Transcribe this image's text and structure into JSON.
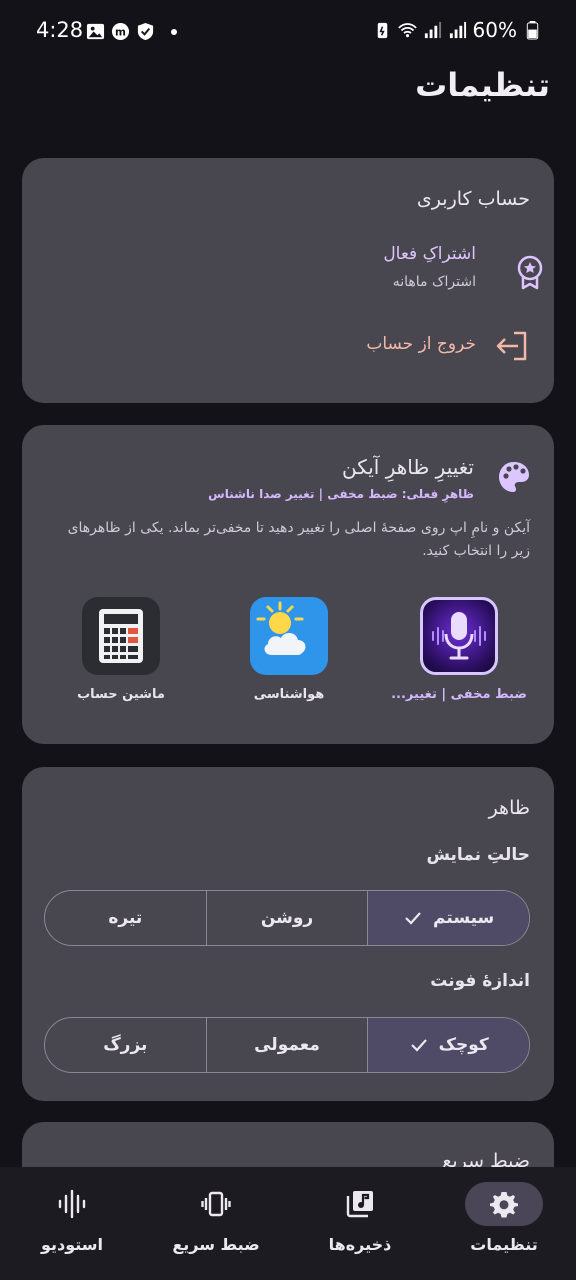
{
  "status_bar": {
    "time": "4:28",
    "battery": "60%",
    "left_icons": [
      "image-icon",
      "messenger-icon",
      "shield-check-icon"
    ],
    "right_icons": [
      "battery-saver-icon",
      "wifi-icon",
      "signal-icon",
      "signal-icon",
      "battery-icon"
    ]
  },
  "page": {
    "title": "تنظیمات"
  },
  "account": {
    "heading": "حساب کاربری",
    "subscription_title": "اشتراکِ فعال",
    "subscription_sub": "اشتراک ماهانه",
    "logout": "خروج از حساب"
  },
  "icon_change": {
    "title": "تغییرِ ظاهرِ آیکن",
    "current": "ظاهرِ فعلی: ضبط مخفی | تغییر صدا ناشناس",
    "description": "آیکن و نامِ اپ روی صفحهٔ اصلی را تغییر دهید تا مخفی‌تر بماند. یکی از ظاهرهای زیر را انتخاب کنید.",
    "options": [
      {
        "label": "ضبط مخفی | تغییر...",
        "icon": "microphone-icon",
        "selected": true
      },
      {
        "label": "هواشناسی",
        "icon": "weather-icon",
        "selected": false
      },
      {
        "label": "ماشین حساب",
        "icon": "calculator-icon",
        "selected": false
      }
    ]
  },
  "appearance": {
    "heading": "ظاهر",
    "display_mode_label": "حالتِ نمایش",
    "display_modes": [
      {
        "label": "سیستم",
        "selected": true
      },
      {
        "label": "روشن",
        "selected": false
      },
      {
        "label": "تیره",
        "selected": false
      }
    ],
    "font_size_label": "اندازهٔ فونت",
    "font_sizes": [
      {
        "label": "کوچک",
        "selected": true
      },
      {
        "label": "معمولی",
        "selected": false
      },
      {
        "label": "بزرگ",
        "selected": false
      }
    ]
  },
  "quick_record": {
    "heading": "ضبط سریع"
  },
  "bottom_nav": {
    "items": [
      {
        "label": "تنظیمات",
        "icon": "gear-icon",
        "active": true
      },
      {
        "label": "ذخیره‌ها",
        "icon": "music-library-icon",
        "active": false
      },
      {
        "label": "ضبط سریع",
        "icon": "vibrate-icon",
        "active": false
      },
      {
        "label": "استودیو",
        "icon": "waveform-icon",
        "active": false
      }
    ]
  },
  "colors": {
    "background": "#131218",
    "card": "#48464e",
    "accent": "#d4b8ff",
    "logout": "#f2b8a8",
    "selected_segment": "#4f4a66",
    "nav_bar": "#1d1b22"
  }
}
